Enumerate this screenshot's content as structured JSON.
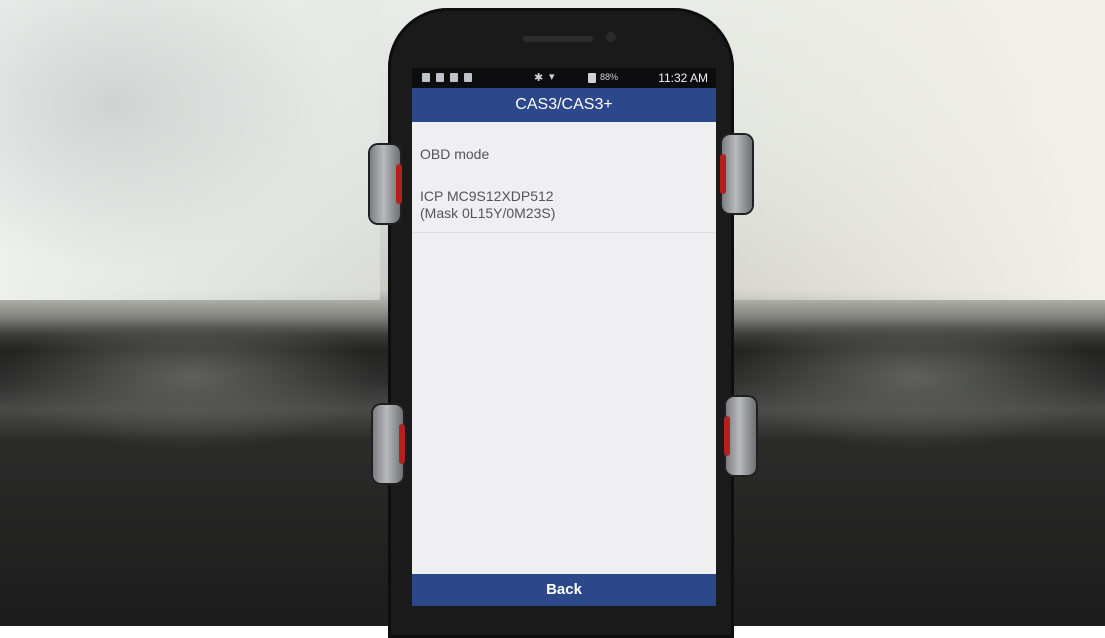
{
  "status_bar": {
    "battery": "88%",
    "time": "11:32 AM"
  },
  "app": {
    "title": "CAS3/CAS3+"
  },
  "list": {
    "items": [
      {
        "label": "OBD mode"
      },
      {
        "line1": "ICP MC9S12XDP512",
        "line2": "(Mask 0L15Y/0M23S)"
      }
    ]
  },
  "nav": {
    "back_label": "Back"
  },
  "icons": {
    "bluetooth": "bluetooth-icon",
    "wifi": "wifi-icon",
    "battery": "battery-icon"
  },
  "colors": {
    "header_blue": "#2c478a",
    "screen_bg": "#efeff1"
  }
}
